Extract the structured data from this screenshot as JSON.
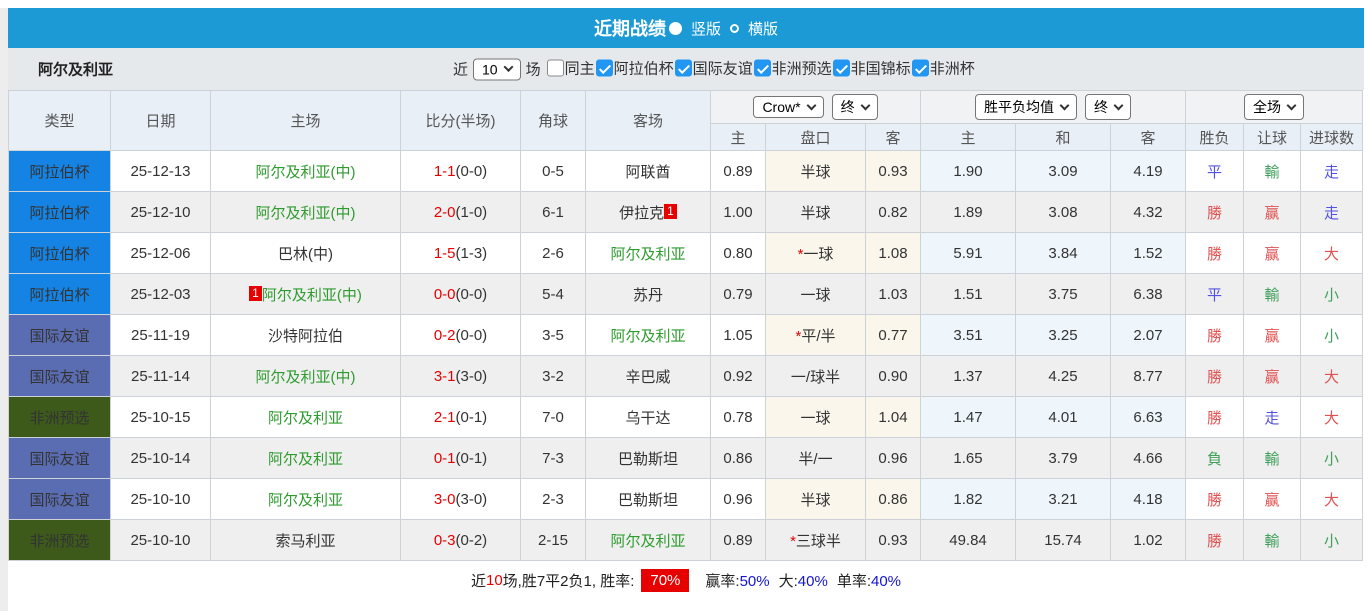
{
  "title_bar": {
    "title": "近期战绩",
    "radio_vertical": "竖版",
    "radio_horizontal": "横版"
  },
  "filter_bar": {
    "near_label": "近",
    "near_value": "10",
    "games_label": "场",
    "team_name": "阿尔及利亚",
    "checkboxes": [
      {
        "label": "同主",
        "checked": false
      },
      {
        "label": "阿拉伯杯",
        "checked": true
      },
      {
        "label": "国际友谊",
        "checked": true
      },
      {
        "label": "非洲预选",
        "checked": true
      },
      {
        "label": "非国锦标",
        "checked": true
      },
      {
        "label": "非洲杯",
        "checked": true
      }
    ]
  },
  "table": {
    "dropdowns": {
      "odds_source": "Crow*",
      "odds_time1": "终",
      "avg_label": "胜平负均值",
      "odds_time2": "终",
      "scope": "全场"
    },
    "columns": [
      "类型",
      "日期",
      "主场",
      "比分(半场)",
      "角球",
      "客场",
      "主",
      "盘口",
      "客",
      "主",
      "和",
      "客",
      "胜负",
      "让球",
      "进球数"
    ],
    "rows": [
      {
        "league": "阿拉伯杯",
        "date": "25-12-13",
        "home": "阿尔及利亚(中)",
        "home_green": true,
        "home_card": "",
        "score": "1-1",
        "half": "(0-0)",
        "corners": "0-5",
        "away": "阿联酋",
        "away_green": false,
        "away_card": "",
        "crow_home": "0.89",
        "handicap_star": "",
        "handicap": "半球",
        "crow_away": "0.93",
        "avg_win": "1.90",
        "avg_draw": "3.09",
        "avg_lose": "4.19",
        "wdl": "平",
        "wdl_color": "blue",
        "handi_res": "輸",
        "handi_color": "green",
        "goal_res": "走",
        "goal_color": "blue"
      },
      {
        "league": "阿拉伯杯",
        "date": "25-12-10",
        "home": "阿尔及利亚(中)",
        "home_green": true,
        "home_card": "",
        "score": "2-0",
        "half": "(1-0)",
        "corners": "6-1",
        "away": "伊拉克",
        "away_green": false,
        "away_card": "1",
        "crow_home": "1.00",
        "handicap_star": "",
        "handicap": "半球",
        "crow_away": "0.82",
        "avg_win": "1.89",
        "avg_draw": "3.08",
        "avg_lose": "4.32",
        "wdl": "勝",
        "wdl_color": "red",
        "handi_res": "赢",
        "handi_color": "red",
        "goal_res": "走",
        "goal_color": "blue"
      },
      {
        "league": "阿拉伯杯",
        "date": "25-12-06",
        "home": "巴林(中)",
        "home_green": false,
        "home_card": "",
        "score": "1-5",
        "half": "(1-3)",
        "corners": "2-6",
        "away": "阿尔及利亚",
        "away_green": true,
        "away_card": "",
        "crow_home": "0.80",
        "handicap_star": "*",
        "handicap": "一球",
        "crow_away": "1.08",
        "avg_win": "5.91",
        "avg_draw": "3.84",
        "avg_lose": "1.52",
        "wdl": "勝",
        "wdl_color": "red",
        "handi_res": "赢",
        "handi_color": "red",
        "goal_res": "大",
        "goal_color": "red"
      },
      {
        "league": "阿拉伯杯",
        "date": "25-12-03",
        "home": "阿尔及利亚(中)",
        "home_green": true,
        "home_card": "1",
        "score": "0-0",
        "half": "(0-0)",
        "corners": "5-4",
        "away": "苏丹",
        "away_green": false,
        "away_card": "",
        "crow_home": "0.79",
        "handicap_star": "",
        "handicap": "一球",
        "crow_away": "1.03",
        "avg_win": "1.51",
        "avg_draw": "3.75",
        "avg_lose": "6.38",
        "wdl": "平",
        "wdl_color": "blue",
        "handi_res": "輸",
        "handi_color": "green",
        "goal_res": "小",
        "goal_color": "green"
      },
      {
        "league": "国际友谊",
        "date": "25-11-19",
        "home": "沙特阿拉伯",
        "home_green": false,
        "home_card": "",
        "score": "0-2",
        "half": "(0-0)",
        "corners": "3-5",
        "away": "阿尔及利亚",
        "away_green": true,
        "away_card": "",
        "crow_home": "1.05",
        "handicap_star": "*",
        "handicap": "平/半",
        "crow_away": "0.77",
        "avg_win": "3.51",
        "avg_draw": "3.25",
        "avg_lose": "2.07",
        "wdl": "勝",
        "wdl_color": "red",
        "handi_res": "赢",
        "handi_color": "red",
        "goal_res": "小",
        "goal_color": "green"
      },
      {
        "league": "国际友谊",
        "date": "25-11-14",
        "home": "阿尔及利亚(中)",
        "home_green": true,
        "home_card": "",
        "score": "3-1",
        "half": "(3-0)",
        "corners": "3-2",
        "away": "辛巴威",
        "away_green": false,
        "away_card": "",
        "crow_home": "0.92",
        "handicap_star": "",
        "handicap": "一/球半",
        "crow_away": "0.90",
        "avg_win": "1.37",
        "avg_draw": "4.25",
        "avg_lose": "8.77",
        "wdl": "勝",
        "wdl_color": "red",
        "handi_res": "赢",
        "handi_color": "red",
        "goal_res": "大",
        "goal_color": "red"
      },
      {
        "league": "非洲预选",
        "date": "25-10-15",
        "home": "阿尔及利亚",
        "home_green": true,
        "home_card": "",
        "score": "2-1",
        "half": "(0-1)",
        "corners": "7-0",
        "away": "乌干达",
        "away_green": false,
        "away_card": "",
        "crow_home": "0.78",
        "handicap_star": "",
        "handicap": "一球",
        "crow_away": "1.04",
        "avg_win": "1.47",
        "avg_draw": "4.01",
        "avg_lose": "6.63",
        "wdl": "勝",
        "wdl_color": "red",
        "handi_res": "走",
        "handi_color": "blue",
        "goal_res": "大",
        "goal_color": "red"
      },
      {
        "league": "国际友谊",
        "date": "25-10-14",
        "home": "阿尔及利亚",
        "home_green": true,
        "home_card": "",
        "score": "0-1",
        "half": "(0-1)",
        "corners": "7-3",
        "away": "巴勒斯坦",
        "away_green": false,
        "away_card": "",
        "crow_home": "0.86",
        "handicap_star": "",
        "handicap": "半/一",
        "crow_away": "0.96",
        "avg_win": "1.65",
        "avg_draw": "3.79",
        "avg_lose": "4.66",
        "wdl": "負",
        "wdl_color": "green",
        "handi_res": "輸",
        "handi_color": "green",
        "goal_res": "小",
        "goal_color": "green"
      },
      {
        "league": "国际友谊",
        "date": "25-10-10",
        "home": "阿尔及利亚",
        "home_green": true,
        "home_card": "",
        "score": "3-0",
        "half": "(3-0)",
        "corners": "2-3",
        "away": "巴勒斯坦",
        "away_green": false,
        "away_card": "",
        "crow_home": "0.96",
        "handicap_star": "",
        "handicap": "半球",
        "crow_away": "0.86",
        "avg_win": "1.82",
        "avg_draw": "3.21",
        "avg_lose": "4.18",
        "wdl": "勝",
        "wdl_color": "red",
        "handi_res": "赢",
        "handi_color": "red",
        "goal_res": "大",
        "goal_color": "red"
      },
      {
        "league": "非洲预选",
        "date": "25-10-10",
        "home": "索马利亚",
        "home_green": false,
        "home_card": "",
        "score": "0-3",
        "half": "(0-2)",
        "corners": "2-15",
        "away": "阿尔及利亚",
        "away_green": true,
        "away_card": "",
        "crow_home": "0.89",
        "handicap_star": "*",
        "handicap": "三球半",
        "crow_away": "0.93",
        "avg_win": "49.84",
        "avg_draw": "15.74",
        "avg_lose": "1.02",
        "wdl": "勝",
        "wdl_color": "red",
        "handi_res": "輸",
        "handi_color": "green",
        "goal_res": "小",
        "goal_color": "green"
      }
    ]
  },
  "summary": {
    "prefix": "近",
    "count": "10",
    "mid": "场,胜7平2负1, 胜率:",
    "win_rate": "70%",
    "parts": [
      {
        "label": "赢率:",
        "value": "50%"
      },
      {
        "label": "大:",
        "value": "40%"
      },
      {
        "label": "单率:",
        "value": "40%"
      }
    ]
  },
  "colors": {
    "accent_blue": "#1b9ad6",
    "league": {
      "阿拉伯杯": "#1583e3",
      "国际友谊": "#5a6cb2",
      "非洲预选": "#3d5a1b"
    },
    "team_green": "#2e9b2e",
    "score_red": "#e60000",
    "result_red": "#e05252",
    "result_green": "#3fa05a",
    "result_blue": "#5252e0",
    "rate_badge_bg": "#e60000",
    "rate_value_blue": "#1414d2"
  }
}
